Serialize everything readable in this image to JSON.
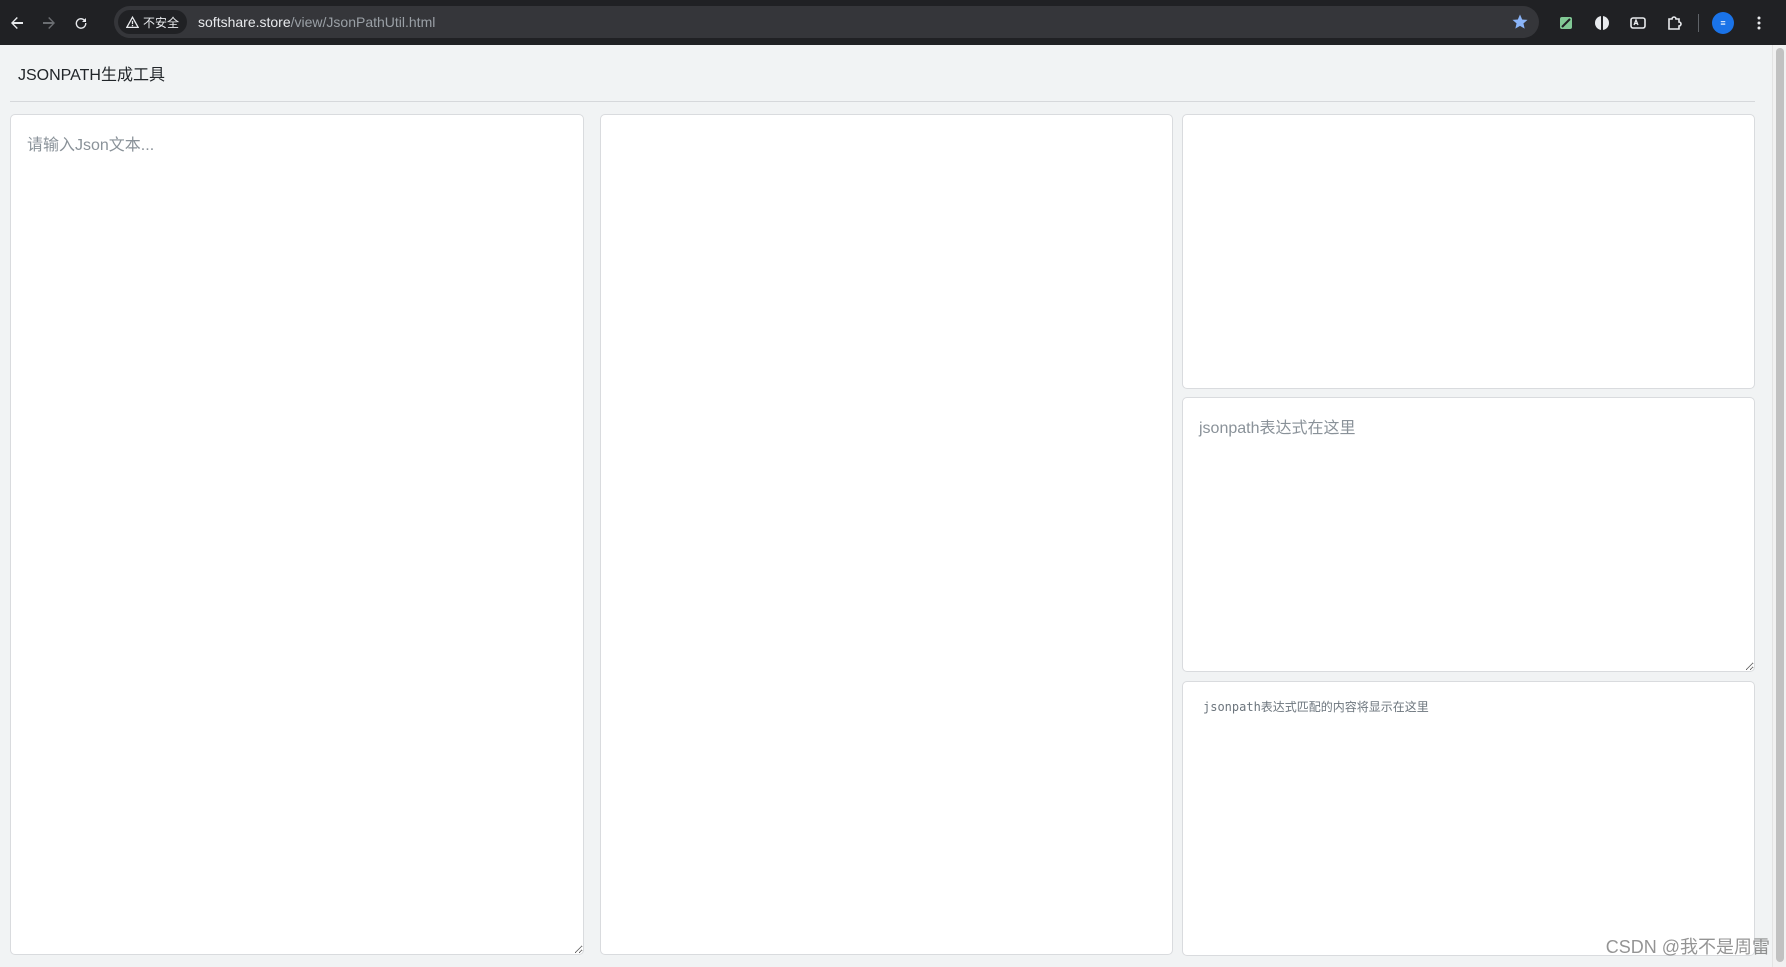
{
  "browser": {
    "security_label": "不安全",
    "url_host": "softshare.store",
    "url_path": "/view/JsonPathUtil.html",
    "avatar_label": "≡"
  },
  "page": {
    "title": "JSONPATH生成工具",
    "json_input_placeholder": "请输入Json文本...",
    "expression_placeholder": "jsonpath表达式在这里",
    "result_placeholder": "jsonpath表达式匹配的内容将显示在这里"
  },
  "watermark": "CSDN @我不是周雷",
  "colors": {
    "chrome_bg": "#202124",
    "omnibox_bg": "#35363a",
    "page_bg": "#f1f3f4",
    "star": "#8ab4f8"
  },
  "icons": [
    "back-icon",
    "forward-icon",
    "reload-icon",
    "warning-icon",
    "star-icon",
    "extension-icons",
    "puzzle-icon",
    "more-icon"
  ]
}
